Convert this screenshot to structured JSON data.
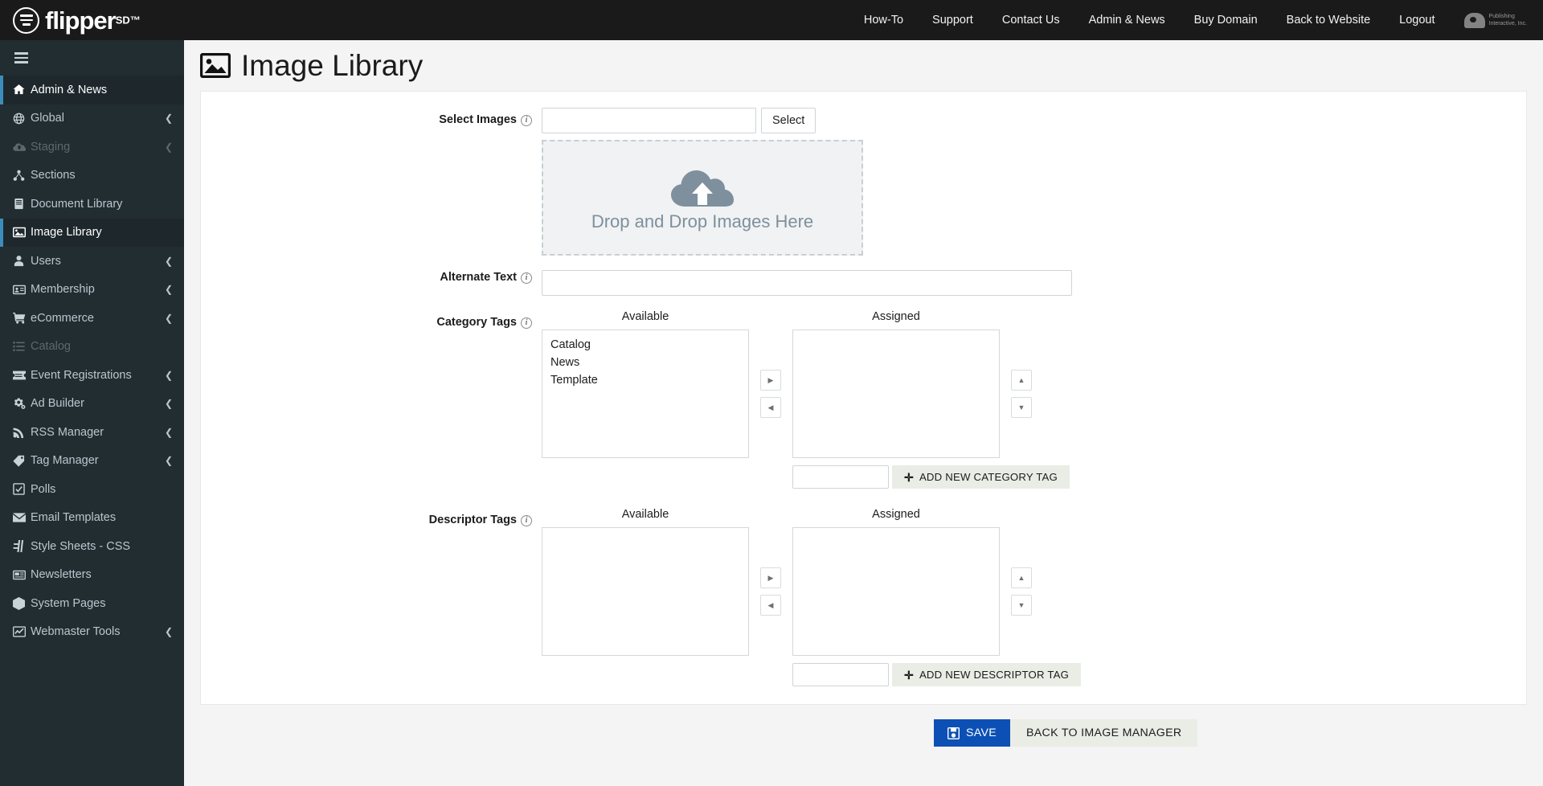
{
  "brand": {
    "name": "flipper",
    "superscript": "SD™"
  },
  "topnav": {
    "items": [
      {
        "label": "How-To"
      },
      {
        "label": "Support"
      },
      {
        "label": "Contact Us"
      },
      {
        "label": "Admin & News"
      },
      {
        "label": "Buy Domain"
      },
      {
        "label": "Back to Website"
      },
      {
        "label": "Logout"
      }
    ],
    "corp_logo": {
      "line1": "Publishing",
      "line2": "Interactive, Inc."
    }
  },
  "sidebar": {
    "items": [
      {
        "label": "Admin & News",
        "icon": "home-icon",
        "active": true,
        "caret": false,
        "disabled": false
      },
      {
        "label": "Global",
        "icon": "globe-icon",
        "active": false,
        "caret": true,
        "disabled": false
      },
      {
        "label": "Staging",
        "icon": "cloud-upload-icon",
        "active": false,
        "caret": true,
        "disabled": true
      },
      {
        "label": "Sections",
        "icon": "sitemap-icon",
        "active": false,
        "caret": false,
        "disabled": false
      },
      {
        "label": "Document Library",
        "icon": "book-icon",
        "active": false,
        "caret": false,
        "disabled": false
      },
      {
        "label": "Image Library",
        "icon": "image-icon",
        "active": true,
        "caret": false,
        "disabled": false
      },
      {
        "label": "Users",
        "icon": "user-icon",
        "active": false,
        "caret": true,
        "disabled": false
      },
      {
        "label": "Membership",
        "icon": "id-card-icon",
        "active": false,
        "caret": true,
        "disabled": false
      },
      {
        "label": "eCommerce",
        "icon": "shopping-cart-icon",
        "active": false,
        "caret": true,
        "disabled": false
      },
      {
        "label": "Catalog",
        "icon": "list-icon",
        "active": false,
        "caret": false,
        "disabled": true
      },
      {
        "label": "Event Registrations",
        "icon": "ticket-icon",
        "active": false,
        "caret": true,
        "disabled": false
      },
      {
        "label": "Ad Builder",
        "icon": "cogs-icon",
        "active": false,
        "caret": true,
        "disabled": false
      },
      {
        "label": "RSS Manager",
        "icon": "rss-icon",
        "active": false,
        "caret": true,
        "disabled": false
      },
      {
        "label": "Tag Manager",
        "icon": "tag-icon",
        "active": false,
        "caret": true,
        "disabled": false
      },
      {
        "label": "Polls",
        "icon": "check-square-icon",
        "active": false,
        "caret": false,
        "disabled": false
      },
      {
        "label": "Email Templates",
        "icon": "envelope-icon",
        "active": false,
        "caret": false,
        "disabled": false
      },
      {
        "label": "Style Sheets - CSS",
        "icon": "css-icon",
        "active": false,
        "caret": false,
        "disabled": false
      },
      {
        "label": "Newsletters",
        "icon": "newspaper-icon",
        "active": false,
        "caret": false,
        "disabled": false
      },
      {
        "label": "System Pages",
        "icon": "cube-icon",
        "active": false,
        "caret": false,
        "disabled": false
      },
      {
        "label": "Webmaster Tools",
        "icon": "chart-line-icon",
        "active": false,
        "caret": true,
        "disabled": false
      }
    ],
    "caret_glyph": "❮",
    "toggle_name": "hamburger-menu"
  },
  "page": {
    "title": "Image Library",
    "title_icon": "image-icon"
  },
  "form": {
    "select_images": {
      "label": "Select Images",
      "value": "",
      "placeholder": "",
      "select_button": "Select"
    },
    "dropzone": {
      "text": "Drop and Drop Images Here",
      "icon": "cloud-upload-icon"
    },
    "alternate_text": {
      "label": "Alternate Text",
      "value": "",
      "placeholder": ""
    },
    "category_tags": {
      "label": "Category Tags",
      "available_header": "Available",
      "assigned_header": "Assigned",
      "available": [
        "Catalog",
        "News",
        "Template"
      ],
      "assigned": [],
      "new_tag_value": "",
      "new_tag_placeholder": "",
      "add_button": "ADD NEW CATEGORY TAG"
    },
    "descriptor_tags": {
      "label": "Descriptor Tags",
      "available_header": "Available",
      "assigned_header": "Assigned",
      "available": [],
      "assigned": [],
      "new_tag_value": "",
      "new_tag_placeholder": "",
      "add_button": "ADD NEW DESCRIPTOR TAG"
    },
    "transfer_buttons": {
      "move_right": "▶",
      "move_left": "◀",
      "move_up": "▲",
      "move_down": "▼"
    },
    "info_glyph": "i"
  },
  "actions": {
    "save_label": "SAVE",
    "save_icon": "floppy-save-icon",
    "back_label": "BACK TO IMAGE MANAGER"
  },
  "colors": {
    "accent_blue": "#0c50b5",
    "sidebar_bg": "#222d32",
    "sidebar_active_bg": "#1e282c",
    "sidebar_active_border": "#3c8dbc",
    "topbar_bg": "#1a1a1a",
    "content_bg": "#f4f4f4",
    "dropzone_icon": "#7e909d",
    "button_gray": "#eaece6"
  }
}
